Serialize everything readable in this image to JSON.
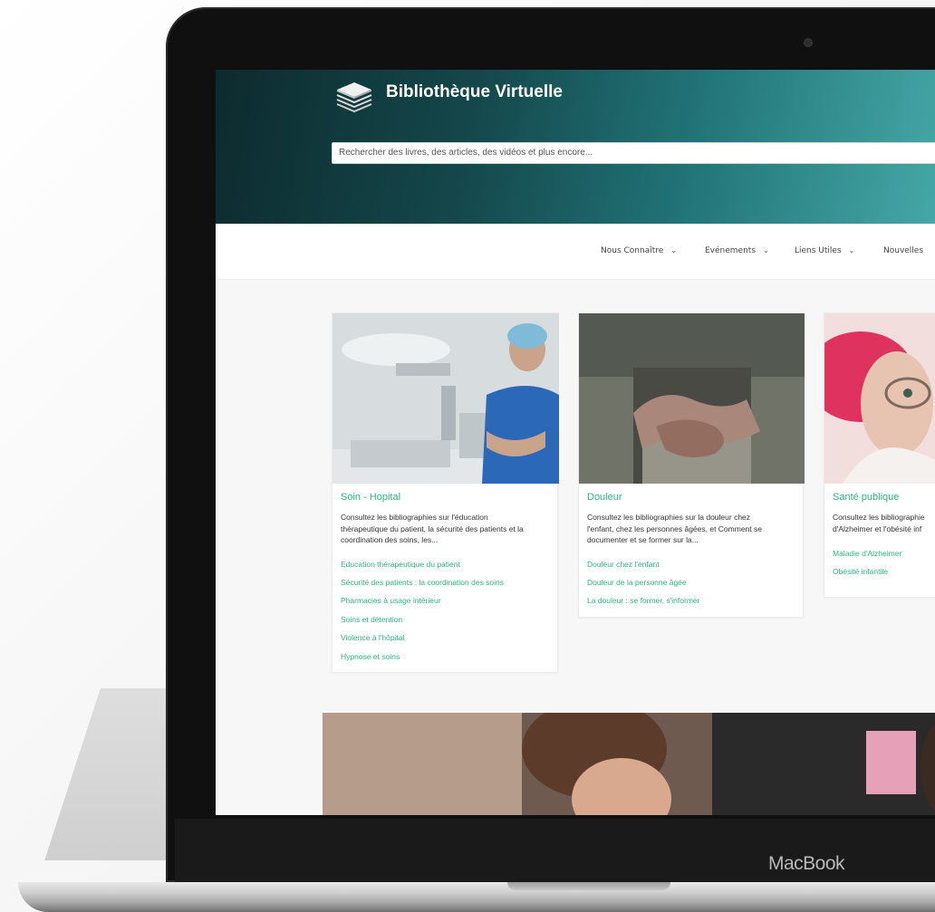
{
  "site": {
    "title": "Bibliothèque Virtuelle"
  },
  "search": {
    "placeholder": "Rechercher des livres, des articles, des vidéos et plus encore..."
  },
  "nav": {
    "items": [
      {
        "label": "Nous Connaître",
        "chevron": "chevron-down-icon"
      },
      {
        "label": "Evénements",
        "chevron": "chevron-down-icon"
      },
      {
        "label": "Liens Utiles",
        "chevron": "chevron-down-icon"
      },
      {
        "label": "Nouvelles"
      }
    ]
  },
  "cards": [
    {
      "title": "Soin - Hopital",
      "desc_lines": [
        "Consultez les bibliographies sur l'éducation",
        "thérapeutique du patient, la sécurité des patients et la",
        "coordination des soins, les..."
      ],
      "links": [
        "Education thérapeutique du patient",
        "Sécurité des patients : la coordination des soins",
        "Pharmacies à usage intérieur",
        "Soins et détention",
        "Violence à l'hôpital",
        "Hypnose et soins"
      ]
    },
    {
      "title": "Douleur",
      "desc_lines": [
        "Consultez les bibliographies sur la douleur chez",
        "l'enfant, chez les personnes âgées, et Comment se",
        "documenter et se former sur la..."
      ],
      "links": [
        "Douleur chez l'enfant",
        "Douleur de la personne âgée",
        "La douleur : se former, s'informer"
      ]
    },
    {
      "title": "Santé publique",
      "desc_lines": [
        "Consultez les bibliographie",
        "d'Alzheimer et l'obésité inf"
      ],
      "links": [
        "Maladie d'Alzheimer",
        "Obésité infantile"
      ]
    }
  ],
  "device": {
    "brand": "MacBook"
  },
  "colors": {
    "accent": "#2cb67d",
    "hero_start": "#0d2b2e",
    "hero_end": "#45a7a7"
  }
}
